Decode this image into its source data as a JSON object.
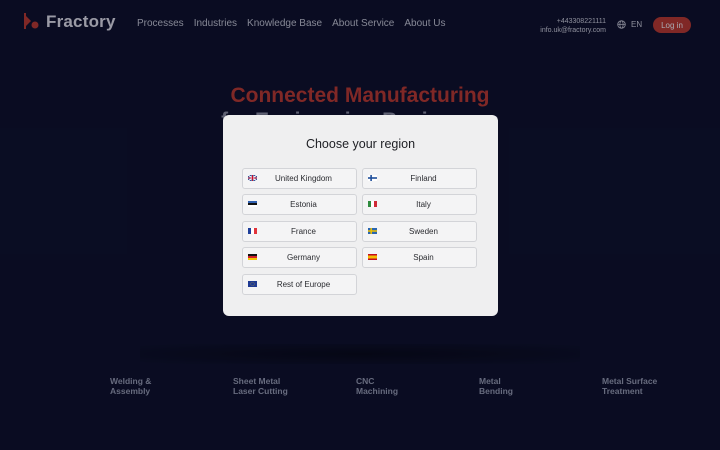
{
  "header": {
    "logo_text": "Fractory",
    "nav": [
      "Processes",
      "Industries",
      "Knowledge Base",
      "About Service",
      "About Us"
    ],
    "phone": "+443308221111",
    "email": "info.uk@fractory.com",
    "language": "EN",
    "login_label": "Log in"
  },
  "hero": {
    "line1": "Connected Manufacturing",
    "line2": "for Engineering Businesses"
  },
  "services": [
    {
      "line1": "Welding &",
      "line2": "Assembly"
    },
    {
      "line1": "Sheet Metal",
      "line2": "Laser Cutting"
    },
    {
      "line1": "CNC",
      "line2": "Machining"
    },
    {
      "line1": "Metal",
      "line2": "Bending"
    },
    {
      "line1": "Metal Surface",
      "line2": "Treatment"
    }
  ],
  "modal": {
    "title": "Choose your region",
    "regions": [
      {
        "label": "United Kingdom",
        "flag": "gb-flag-icon"
      },
      {
        "label": "Finland",
        "flag": "fi-flag-icon"
      },
      {
        "label": "Estonia",
        "flag": "ee-flag-icon"
      },
      {
        "label": "Italy",
        "flag": "it-flag-icon"
      },
      {
        "label": "France",
        "flag": "fr-flag-icon"
      },
      {
        "label": "Sweden",
        "flag": "se-flag-icon"
      },
      {
        "label": "Germany",
        "flag": "de-flag-icon"
      },
      {
        "label": "Spain",
        "flag": "es-flag-icon"
      },
      {
        "label": "Rest of Europe",
        "flag": "eu-flag-icon"
      }
    ]
  },
  "colors": {
    "accent": "#c0392b",
    "background": "#0b0f26",
    "modal_bg": "#efeff0"
  }
}
